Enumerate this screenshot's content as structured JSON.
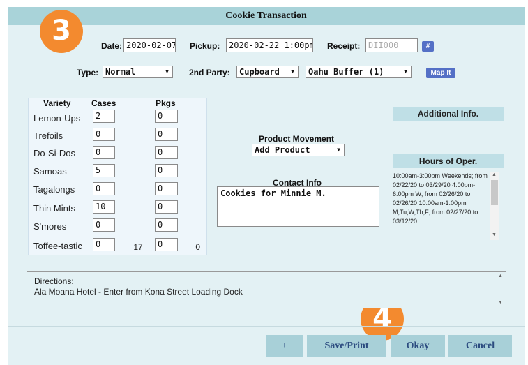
{
  "window": {
    "title": "Cookie Transaction"
  },
  "callouts": [
    "3",
    "4"
  ],
  "header": {
    "date_label": "Date:",
    "date_value": "2020-02-07",
    "pickup_label": "Pickup:",
    "pickup_value": "2020-02-22 1:00pm",
    "receipt_label": "Receipt:",
    "receipt_placeholder": "DII000",
    "hash_button": "#",
    "type_label": "Type:",
    "type_value": "Normal",
    "party_label": "2nd Party:",
    "party_value": "Cupboard",
    "location_value": "Oahu Buffer (1)",
    "map_button": "Map It"
  },
  "varieties": {
    "headers": {
      "variety": "Variety",
      "cases": "Cases",
      "pkgs": "Pkgs"
    },
    "rows": [
      {
        "name": "Lemon-Ups",
        "cases": "2",
        "pkgs": "0"
      },
      {
        "name": "Trefoils",
        "cases": "0",
        "pkgs": "0"
      },
      {
        "name": "Do-Si-Dos",
        "cases": "0",
        "pkgs": "0"
      },
      {
        "name": "Samoas",
        "cases": "5",
        "pkgs": "0"
      },
      {
        "name": "Tagalongs",
        "cases": "0",
        "pkgs": "0"
      },
      {
        "name": "Thin Mints",
        "cases": "10",
        "pkgs": "0"
      },
      {
        "name": "S'mores",
        "cases": "0",
        "pkgs": "0"
      },
      {
        "name": "Toffee-tastic",
        "cases": "0",
        "pkgs": "0"
      }
    ],
    "cases_total": "= 17",
    "pkgs_total": "= 0"
  },
  "movement": {
    "label": "Product Movement",
    "value": "Add Product"
  },
  "contact": {
    "label": "Contact Info",
    "value": "Cookies for Minnie M."
  },
  "sidebar": {
    "additional_label": "Additional Info.",
    "hours_label": "Hours of Oper.",
    "hours_text": "10:00am-3:00pm Weekends; from 02/22/20 to 03/29/20 4:00pm-6:00pm W; from 02/26/20 to 02/26/20 10:00am-1:00pm M,Tu,W,Th,F; from 02/27/20 to 03/12/20"
  },
  "directions": {
    "label": "Directions:",
    "text": "Ala Moana Hotel - Enter from Kona Street Loading Dock"
  },
  "footer": {
    "plus": "+",
    "save_print": "Save/Print",
    "okay": "Okay",
    "cancel": "Cancel"
  },
  "colors": {
    "accent_orange": "#f38a2f",
    "title_bar": "#a9d3d9",
    "panel": "#e3f1f4",
    "mini_button": "#5470c6",
    "footer_button": "#a8d0d8"
  }
}
